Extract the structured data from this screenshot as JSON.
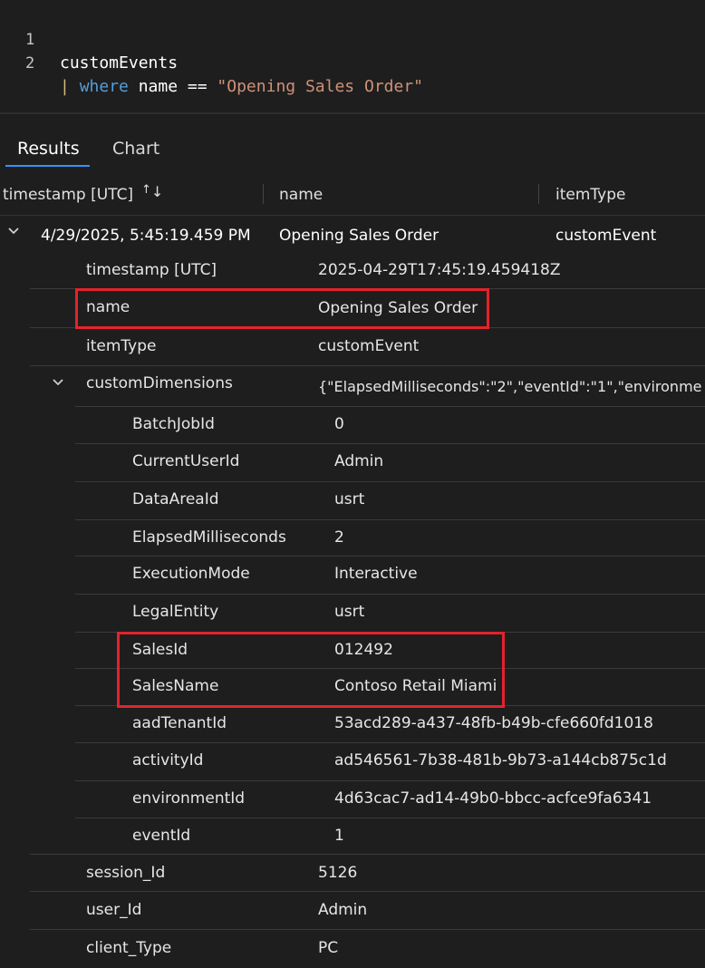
{
  "editor": {
    "lines": [
      {
        "num": "1",
        "text": "customEvents"
      },
      {
        "num": "2",
        "pipe": "|",
        "keyword": "where",
        "field": " name == ",
        "string": "\"Opening Sales Order\""
      }
    ]
  },
  "tabs": [
    {
      "label": "Results",
      "active": true
    },
    {
      "label": "Chart",
      "active": false
    }
  ],
  "columns": [
    "timestamp [UTC]",
    "name",
    "itemType"
  ],
  "row": {
    "timestamp": "4/29/2025, 5:45:19.459 PM",
    "name": "Opening Sales Order",
    "itemType": "customEvent"
  },
  "details": [
    {
      "key": "timestamp [UTC]",
      "value": "2025-04-29T17:45:19.459418Z"
    },
    {
      "key": "name",
      "value": "Opening Sales Order"
    },
    {
      "key": "itemType",
      "value": "customEvent"
    },
    {
      "key": "customDimensions",
      "value": "{\"ElapsedMilliseconds\":\"2\",\"eventId\":\"1\",\"environme"
    }
  ],
  "customDimensions": [
    {
      "key": "BatchJobId",
      "value": "0"
    },
    {
      "key": "CurrentUserId",
      "value": "Admin"
    },
    {
      "key": "DataAreaId",
      "value": "usrt"
    },
    {
      "key": "ElapsedMilliseconds",
      "value": "2"
    },
    {
      "key": "ExecutionMode",
      "value": "Interactive"
    },
    {
      "key": "LegalEntity",
      "value": "usrt"
    },
    {
      "key": "SalesId",
      "value": "012492"
    },
    {
      "key": "SalesName",
      "value": "Contoso Retail Miami"
    },
    {
      "key": "aadTenantId",
      "value": "53acd289-a437-48fb-b49b-cfe660fd1018"
    },
    {
      "key": "activityId",
      "value": "ad546561-7b38-481b-9b73-a144cb875c1d"
    },
    {
      "key": "environmentId",
      "value": "4d63cac7-ad14-49b0-bbcc-acfce9fa6341"
    },
    {
      "key": "eventId",
      "value": "1"
    }
  ],
  "trailing": [
    {
      "key": "session_Id",
      "value": "5126"
    },
    {
      "key": "user_Id",
      "value": "Admin"
    },
    {
      "key": "client_Type",
      "value": "PC"
    }
  ],
  "colors": {
    "background": "#1e1e1e",
    "accent": "#3794ff",
    "highlight": "#e3232c",
    "keyword": "#569cd6",
    "string": "#ce9178"
  }
}
